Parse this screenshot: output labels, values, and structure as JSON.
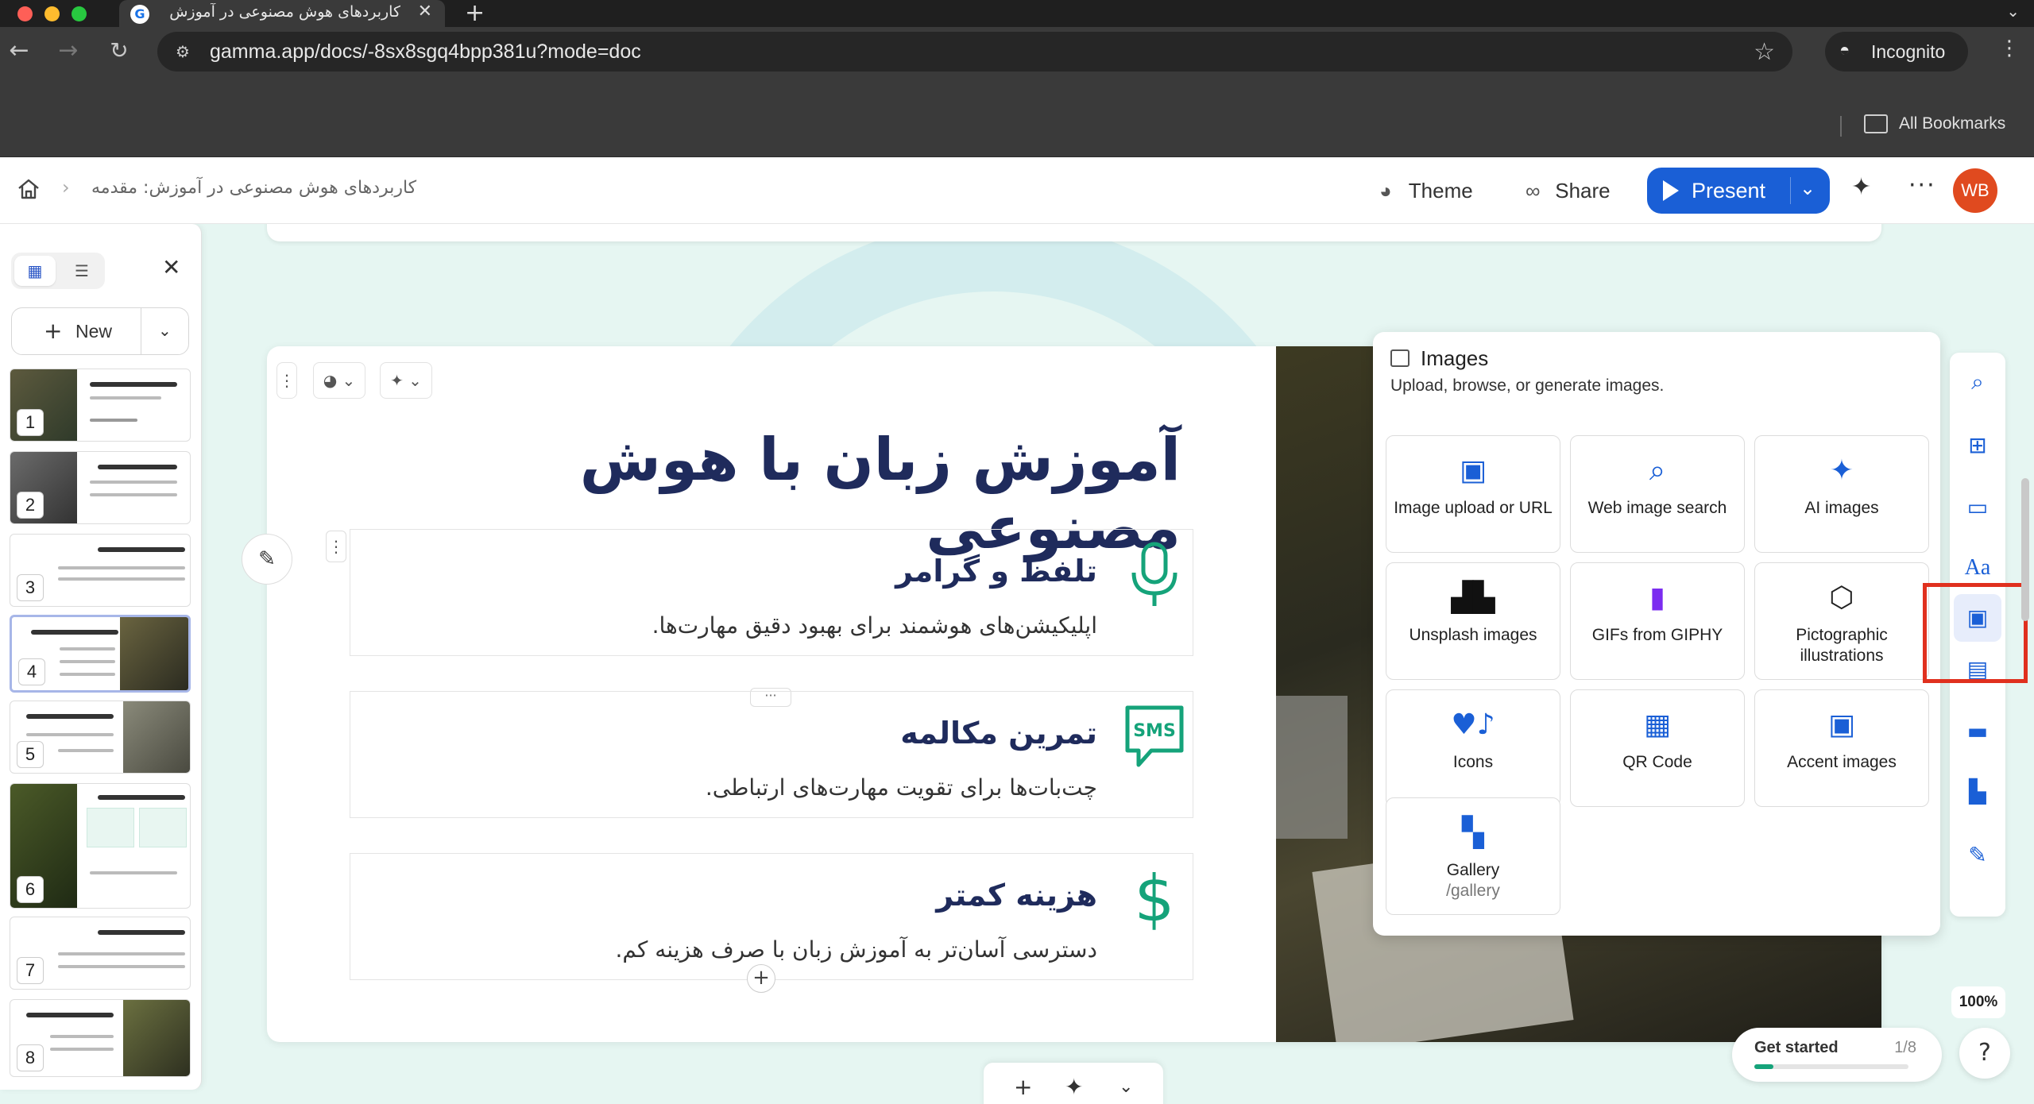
{
  "browser": {
    "tab_title": "کاربردهای هوش مصنوعی در آموزش",
    "url": "gamma.app/docs/-8sx8sgq4bpp381u?mode=doc",
    "incognito_label": "Incognito",
    "bookmarks_label": "All Bookmarks"
  },
  "header": {
    "breadcrumb": "کاربردهای هوش مصنوعی در آموزش: مقدمه",
    "theme_label": "Theme",
    "share_label": "Share",
    "present_label": "Present",
    "avatar_initials": "WB"
  },
  "left_panel": {
    "new_label": "New",
    "slides": [
      {
        "number": "1"
      },
      {
        "number": "2"
      },
      {
        "number": "3"
      },
      {
        "number": "4"
      },
      {
        "number": "5"
      },
      {
        "number": "6"
      },
      {
        "number": "7"
      },
      {
        "number": "8"
      }
    ],
    "active_slide": "4"
  },
  "slide": {
    "title": "آموزش زبان با هوش مصنوعی",
    "features": [
      {
        "title": "تلفظ و گرامر",
        "desc": "اپلیکیشن‌های هوشمند برای بهبود دقیق مهارت‌ها.",
        "icon": "microphone-icon"
      },
      {
        "title": "تمرین مکالمه",
        "desc": "چت‌بات‌ها برای تقویت مهارت‌های ارتباطی.",
        "icon": "sms-icon",
        "icon_text": "SMS"
      },
      {
        "title": "هزینه کمتر",
        "desc": "دسترسی آسان‌تر به آموزش زبان با صرف هزینه کم.",
        "icon": "dollar-icon",
        "icon_text": "$"
      }
    ]
  },
  "images_panel": {
    "title": "Images",
    "subtitle": "Upload, browse, or generate images.",
    "options": [
      {
        "label": "Image upload or URL",
        "icon": "image-upload-icon"
      },
      {
        "label": "Web image search",
        "icon": "search-icon"
      },
      {
        "label": "AI images",
        "icon": "sparkle-icon"
      },
      {
        "label": "Unsplash images",
        "icon": "unsplash-icon"
      },
      {
        "label": "GIFs from GIPHY",
        "icon": "giphy-icon"
      },
      {
        "label": "Pictographic illustrations",
        "icon": "pictographic-icon"
      },
      {
        "label": "Icons",
        "icon": "icons-icon"
      },
      {
        "label": "QR Code",
        "icon": "qr-code-icon"
      },
      {
        "label": "Accent images",
        "icon": "accent-image-icon"
      },
      {
        "label": "Gallery",
        "sublabel": "/gallery",
        "icon": "gallery-icon"
      }
    ]
  },
  "status": {
    "zoom": "100%",
    "get_started_label": "Get started",
    "get_started_progress": "1/8",
    "get_started_fraction": 0.125
  },
  "colors": {
    "accent": "#1a5fd6",
    "icon_green": "#15a37a",
    "title_navy": "#1f2b5c",
    "highlight_red": "#e0301e"
  }
}
